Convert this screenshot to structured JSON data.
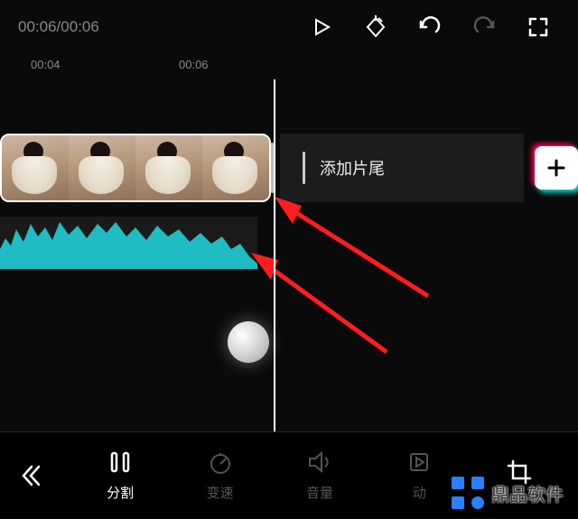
{
  "time": {
    "current": "00:06",
    "total": "00:06",
    "sep": "/"
  },
  "ruler": {
    "t1": "00:04",
    "t2": "00:06"
  },
  "ending": {
    "label": "添加片尾"
  },
  "tools": {
    "split": "分割",
    "speed": "变速",
    "volume": "音量",
    "animate": "动",
    "crop": ""
  },
  "watermark": {
    "text": "鼎品软件"
  },
  "colors": {
    "waveform": "#1fbcc3",
    "arrow": "#ff1d1d"
  }
}
